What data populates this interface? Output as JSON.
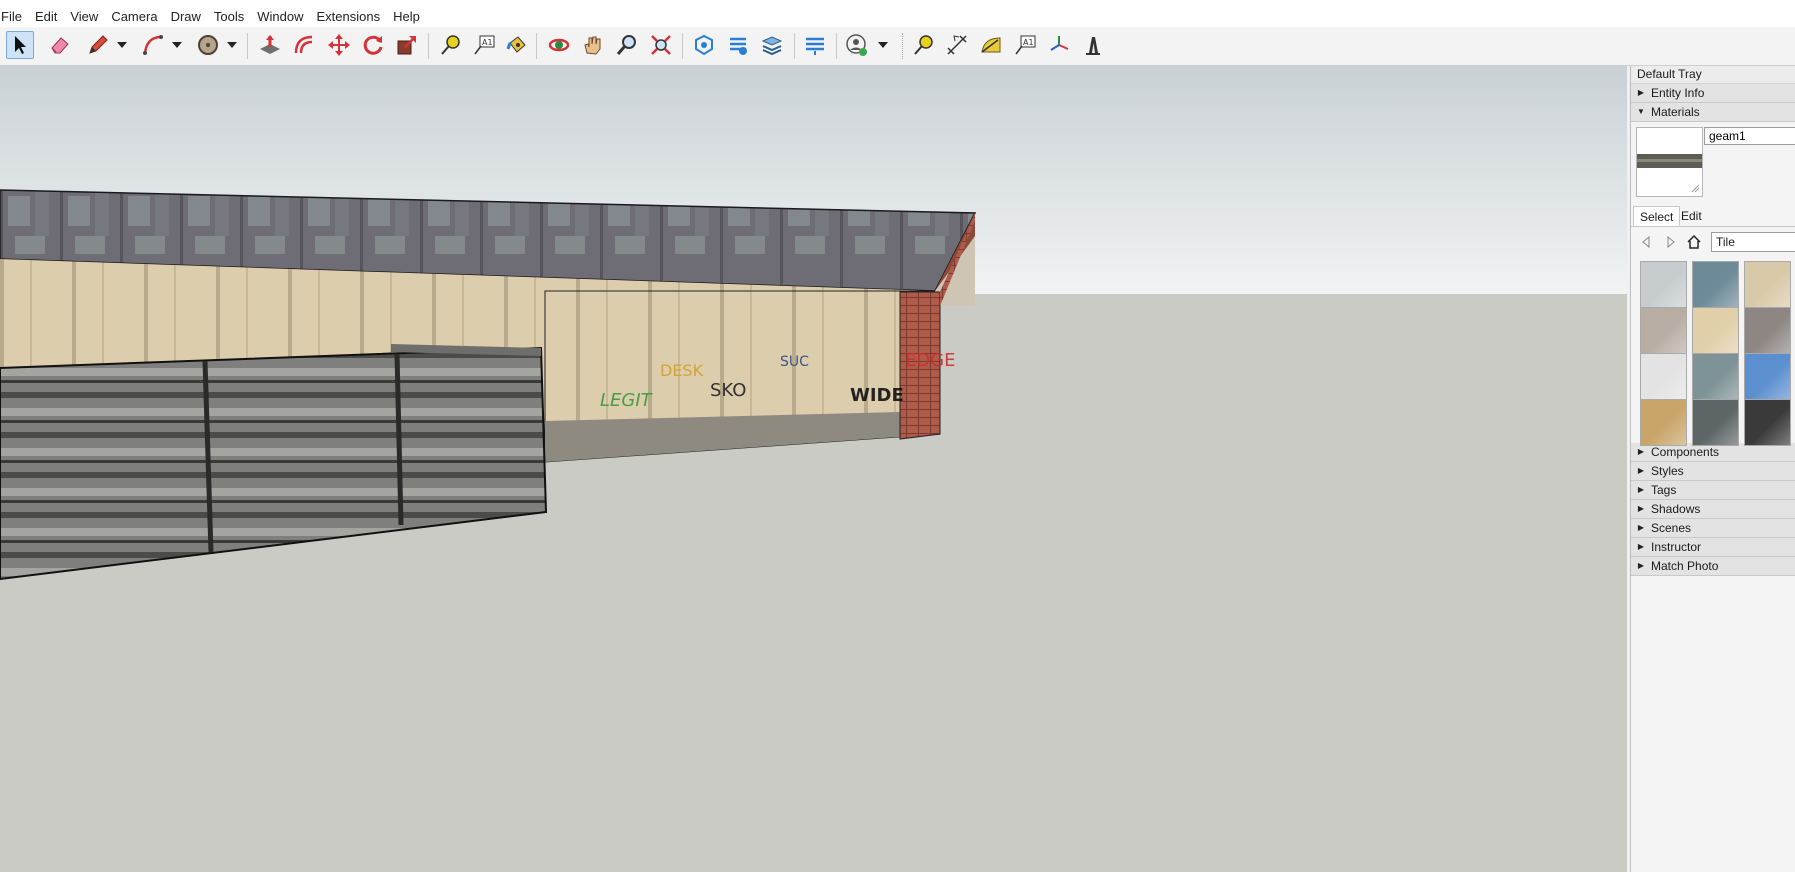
{
  "menu": [
    "File",
    "Edit",
    "View",
    "Camera",
    "Draw",
    "Tools",
    "Window",
    "Extensions",
    "Help"
  ],
  "toolbar": {
    "tools": [
      "select-icon",
      "eraser-icon",
      "pencil-line-icon",
      "arc-icon",
      "shapes-icon",
      "push-pull-icon",
      "offset-icon",
      "move-icon",
      "rotate-icon",
      "scale-icon",
      "tape-measure-icon",
      "text-icon",
      "paint-bucket-icon",
      "orbit-icon",
      "pan-icon",
      "zoom-icon",
      "zoom-extents-icon",
      "3d-warehouse-icon",
      "extension-warehouse-icon",
      "layout-icon",
      "extension-manager-icon",
      "account-icon",
      "tape-measure-icon",
      "dimension-icon",
      "protractor-icon",
      "text-icon",
      "axes-icon",
      "3d-text-icon"
    ]
  },
  "colors": {
    "accent": "#3d7ec6",
    "sky": "#cfd6da",
    "ground": "#cbcbc6"
  },
  "tray": {
    "title": "Default Tray",
    "panels_top": [
      {
        "label": "Entity Info",
        "expanded": false
      },
      {
        "label": "Materials",
        "expanded": true
      }
    ],
    "materials": {
      "name_value": "geam1",
      "tab_select": "Select",
      "tab_edit": "Edit",
      "library": "Tile",
      "swatches": [
        "#c7cdcf",
        "#6d8a99",
        "#d8c9a8",
        "#b8ada3",
        "#e0cfa9",
        "#8d8683",
        "#e3e3e3",
        "#7d9396",
        "#5c8fcf",
        "#c9a56a",
        "#5d6566",
        "#3a3a3a"
      ]
    },
    "panels_bottom": [
      "Components",
      "Styles",
      "Tags",
      "Shadows",
      "Scenes",
      "Instructor",
      "Match Photo"
    ]
  }
}
